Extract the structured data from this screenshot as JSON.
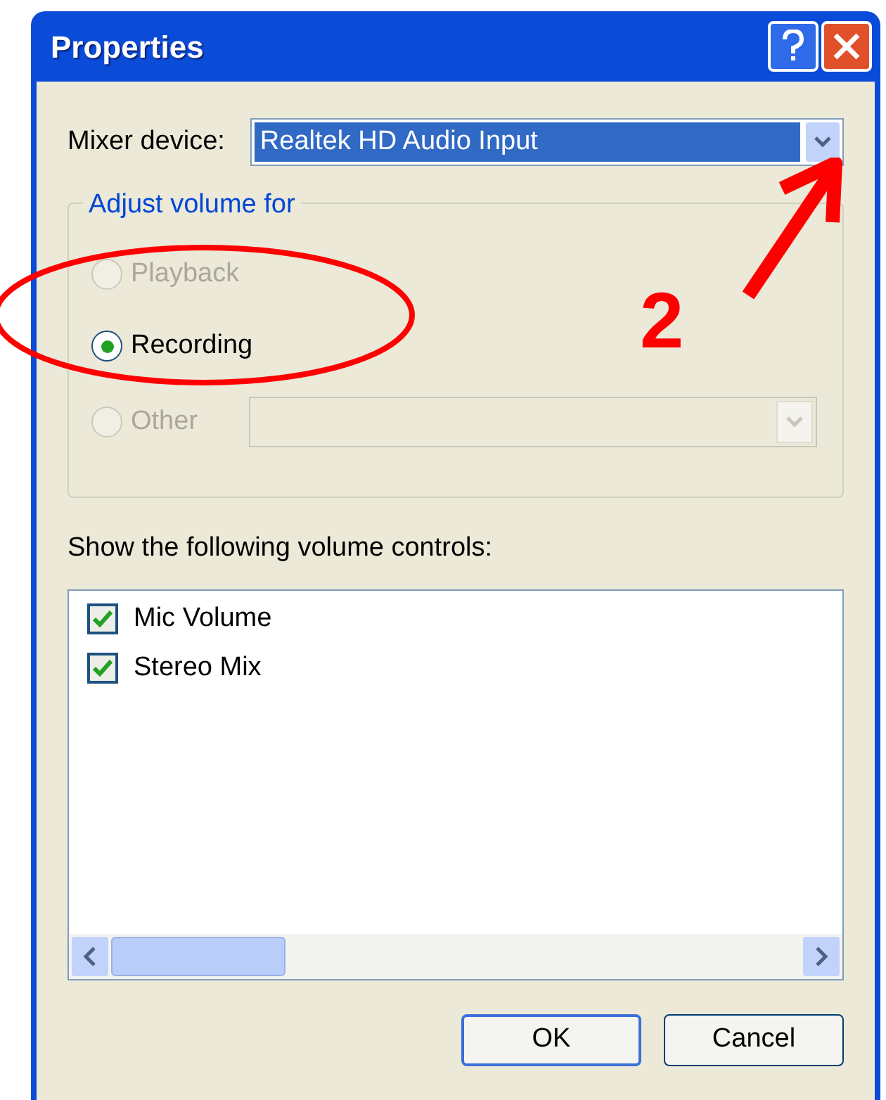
{
  "window": {
    "title": "Properties"
  },
  "mixer_device": {
    "label": "Mixer device:",
    "value": "Realtek HD Audio Input"
  },
  "adjust_group": {
    "title": "Adjust volume for",
    "options": [
      {
        "label": "Playback",
        "selected": false,
        "disabled": true
      },
      {
        "label": "Recording",
        "selected": true,
        "disabled": false
      },
      {
        "label": "Other",
        "selected": false,
        "disabled": true
      }
    ],
    "other_dropdown": {
      "disabled": true
    }
  },
  "controls_label": "Show the following volume controls:",
  "controls": [
    {
      "label": "Mic Volume",
      "checked": true
    },
    {
      "label": "Stereo Mix",
      "checked": true
    }
  ],
  "buttons": [
    {
      "label": "OK",
      "default": true
    },
    {
      "label": "Cancel",
      "default": false
    }
  ],
  "annotation": {
    "label": "2"
  }
}
